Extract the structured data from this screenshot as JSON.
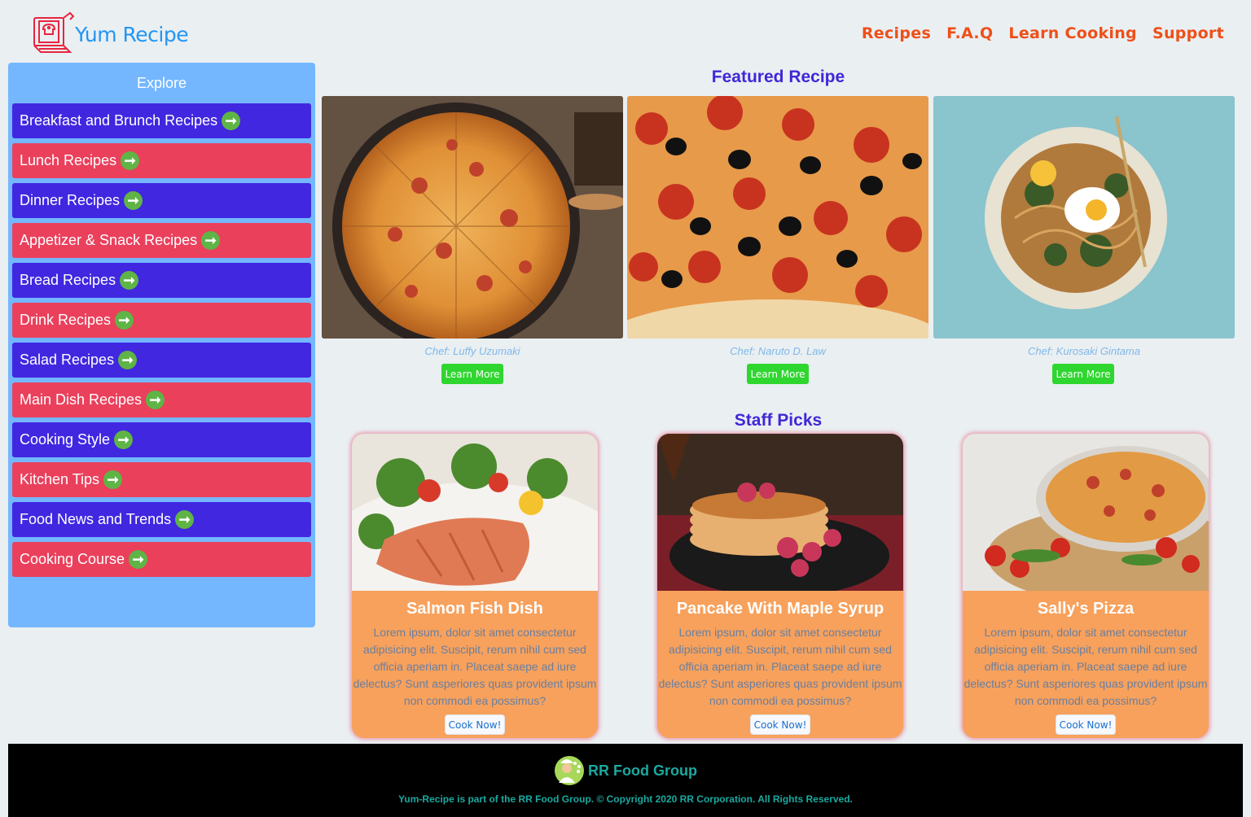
{
  "header": {
    "brand": "Yum Recipe",
    "nav": [
      "Recipes",
      "F.A.Q",
      "Learn Cooking",
      "Support"
    ]
  },
  "sidebar": {
    "title": "Explore",
    "items": [
      {
        "label": "Breakfast and Brunch Recipes",
        "color": "blue"
      },
      {
        "label": "Lunch Recipes",
        "color": "red"
      },
      {
        "label": "Dinner Recipes",
        "color": "blue"
      },
      {
        "label": "Appetizer & Snack Recipes",
        "color": "red"
      },
      {
        "label": "Bread Recipes",
        "color": "blue"
      },
      {
        "label": "Drink Recipes",
        "color": "red"
      },
      {
        "label": "Salad Recipes",
        "color": "blue"
      },
      {
        "label": "Main Dish Recipes",
        "color": "red"
      },
      {
        "label": "Cooking Style",
        "color": "blue"
      },
      {
        "label": "Kitchen Tips",
        "color": "red"
      },
      {
        "label": "Food News and Trends",
        "color": "blue"
      },
      {
        "label": "Cooking Course",
        "color": "red"
      }
    ]
  },
  "featured": {
    "title": "Featured Recipe",
    "items": [
      {
        "chef": "Chef: Luffy Uzumaki",
        "button": "Learn More"
      },
      {
        "chef": "Chef: Naruto D. Law",
        "button": "Learn More"
      },
      {
        "chef": "Chef: Kurosaki Gintama",
        "button": "Learn More"
      }
    ]
  },
  "staff_picks": {
    "title": "Staff Picks",
    "items": [
      {
        "title": "Salmon Fish Dish",
        "text": "Lorem ipsum, dolor sit amet consectetur adipisicing elit. Suscipit, rerum nihil cum sed officia aperiam in. Placeat saepe ad iure delectus? Sunt asperiores quas provident ipsum non commodi ea possimus?",
        "button": "Cook Now!"
      },
      {
        "title": "Pancake With Maple Syrup",
        "text": "Lorem ipsum, dolor sit amet consectetur adipisicing elit. Suscipit, rerum nihil cum sed officia aperiam in. Placeat saepe ad iure delectus? Sunt asperiores quas provident ipsum non commodi ea possimus?",
        "button": "Cook Now!"
      },
      {
        "title": "Sally's Pizza",
        "text": "Lorem ipsum, dolor sit amet consectetur adipisicing elit. Suscipit, rerum nihil cum sed officia aperiam in. Placeat saepe ad iure delectus? Sunt asperiores quas provident ipsum non commodi ea possimus?",
        "button": "Cook Now!"
      }
    ]
  },
  "footer": {
    "brand": "RR Food Group",
    "copyright": "Yum-Recipe is part of the RR Food Group. © Copyright 2020 RR Corporation. All Rights Reserved."
  },
  "colors": {
    "nav": "#ef4f17",
    "sidebar_bg": "#74b7ff",
    "item_blue": "#4127e0",
    "item_red": "#ea405c",
    "arrow": "#5fb446",
    "heading": "#4127d6",
    "card": "#f7a15c",
    "learn_button": "#2fd62f",
    "footer_text": "#1aa9a0"
  }
}
